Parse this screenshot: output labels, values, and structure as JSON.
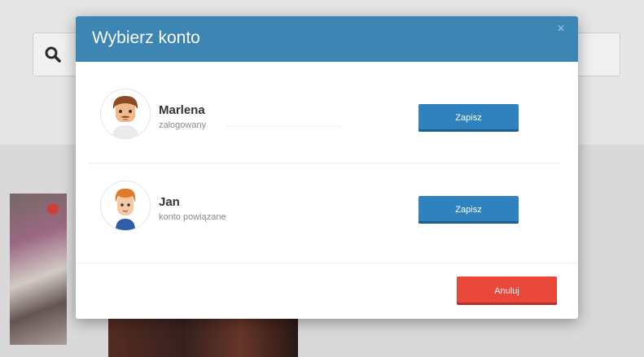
{
  "background": {
    "search_icon": "search-icon"
  },
  "modal": {
    "title": "Wybierz konto",
    "close_icon": "close-icon",
    "accounts": [
      {
        "name": "Marlena",
        "status": "zalogowany",
        "action_label": "Zapisz",
        "avatar_icon": "avatar-man-icon"
      },
      {
        "name": "Jan",
        "status": "konto powiązane",
        "action_label": "Zapisz",
        "avatar_icon": "avatar-boy-icon"
      }
    ],
    "cancel_label": "Anuluj"
  },
  "colors": {
    "header": "#3d86b4",
    "primary_button": "#2f82bd",
    "cancel_button": "#e8473a"
  }
}
